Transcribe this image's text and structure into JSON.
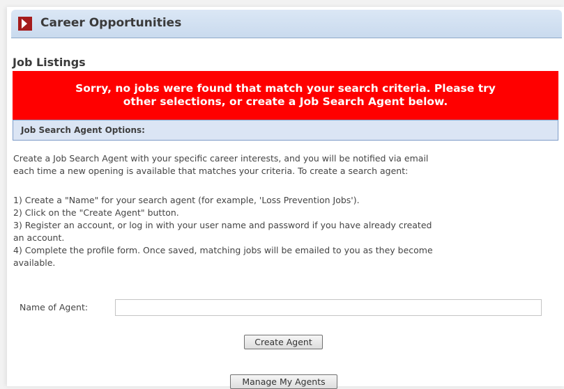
{
  "header": {
    "title": "Career Opportunities",
    "icon": "chevron-right-icon",
    "icon_color": "#a51b1b"
  },
  "section": {
    "title": "Job Listings"
  },
  "error_banner": {
    "line1": "Sorry, no jobs were found that match your search criteria. Please try",
    "line2": "other selections, or create a Job Search Agent below.",
    "color": "#ff0000"
  },
  "options": {
    "label": "Job Search Agent Options:"
  },
  "instructions": {
    "intro_line1": "Create a Job Search Agent with your specific career interests, and you will be notified via email",
    "intro_line2": "each time a new opening is available that matches your criteria. To create a search agent:",
    "step1": "1) Create a \"Name\" for your search agent (for example, 'Loss Prevention Jobs').",
    "step2": "2) Click on the \"Create Agent\" button.",
    "step3_line1": "3) Register an account, or log in with your user name and password if you have already created",
    "step3_line2": "an account.",
    "step4_line1": "4) Complete the profile form. Once saved, matching jobs will be emailed to you as they become",
    "step4_line2": "available."
  },
  "agent_form": {
    "name_label": "Name of Agent:",
    "name_value": "",
    "create_button": "Create Agent",
    "manage_button": "Manage My Agents"
  }
}
